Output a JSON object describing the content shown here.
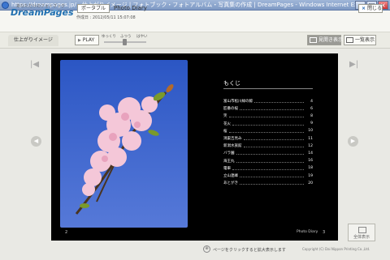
{
  "window": {
    "title": "https://dreampages.jp/ - 仕上がりイメージ | フォトブック・フォトアルバム・写真集の作成 | DreamPages - Windows Internet Explorer",
    "minimize": "_",
    "maximize": "□",
    "close": "×"
  },
  "header": {
    "logo_tagline": "あなただけのフォトブック",
    "logo": "DreamPages",
    "portable_tab": "ポータブル",
    "album_title": "Photo Diary",
    "made_date": "作成日 : 2012/05/11 15:07:08",
    "close_label": "閉じる",
    "close_x": "×"
  },
  "toolbar": {
    "finish_tab": "仕上がりイメージ",
    "play_label": "PLAY",
    "speed_slow": "ゆっくり",
    "speed_normal": "ふつう",
    "speed_fast": "はやい",
    "speed_level": 0.5,
    "view_spread": "見開き表示",
    "view_list": "一覧表示"
  },
  "nav": {
    "first": "|◀",
    "last": "▶|",
    "prev": "◀",
    "next": "▶"
  },
  "book": {
    "toc_title": "もくじ",
    "toc": [
      {
        "label": "富山市松川緑の鯨",
        "page": "4"
      },
      {
        "label": "匠番の桜",
        "page": "6"
      },
      {
        "label": "笑",
        "page": "8"
      },
      {
        "label": "花火",
        "page": "9"
      },
      {
        "label": "桜",
        "page": "10"
      },
      {
        "label": "鴻巣吉見み",
        "page": "11"
      },
      {
        "label": "新潟水族館",
        "page": "12"
      },
      {
        "label": "バラ園",
        "page": "14"
      },
      {
        "label": "海王丸",
        "page": "16"
      },
      {
        "label": "電車",
        "page": "18"
      },
      {
        "label": "立山連峰",
        "page": "19"
      },
      {
        "label": "あとがき",
        "page": "20"
      }
    ],
    "left_page_number": "2",
    "right_page_label": "Photo Diary",
    "right_page_number": "3"
  },
  "footer": {
    "fullscreen": "全体表示",
    "hint": "ページをクリックすると拡大表示します",
    "copyright": "Copyright (C) Dai Nippon Printing Co.,Ltd."
  },
  "colors": {
    "sky": "#2b56c4",
    "blossom": "#f2c4d6",
    "logo": "#1f6fb0"
  }
}
